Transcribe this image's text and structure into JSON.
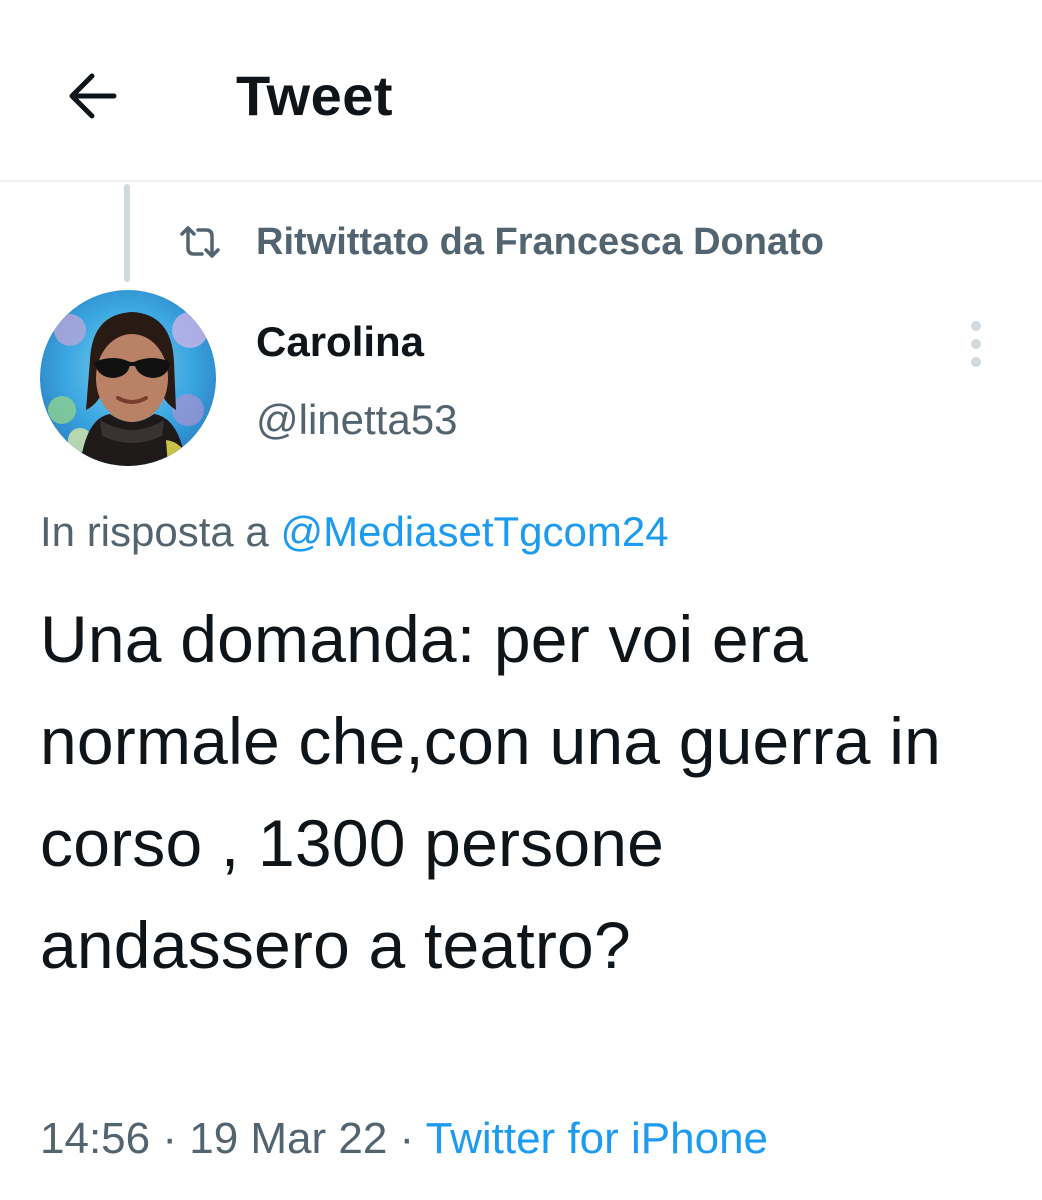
{
  "header": {
    "title": "Tweet",
    "back_icon": "arrow-left-icon"
  },
  "retweet": {
    "icon": "retweet-icon",
    "label": "Ritwittato da Francesca Donato"
  },
  "author": {
    "display_name": "Carolina",
    "handle": "@linetta53"
  },
  "reply": {
    "prefix": "In risposta a ",
    "mention": "@MediasetTgcom24"
  },
  "tweet": {
    "text": "Una domanda: per voi era normale che,con una guerra in corso , 1300 persone andassero a teatro?"
  },
  "meta": {
    "time": "14:56",
    "sep1": " · ",
    "date": "19 Mar 22",
    "sep2": " · ",
    "client": "Twitter for iPhone"
  },
  "colors": {
    "text": "#0f1419",
    "secondary": "#536471",
    "link": "#1d9bf0",
    "divider": "#eff3f4"
  }
}
